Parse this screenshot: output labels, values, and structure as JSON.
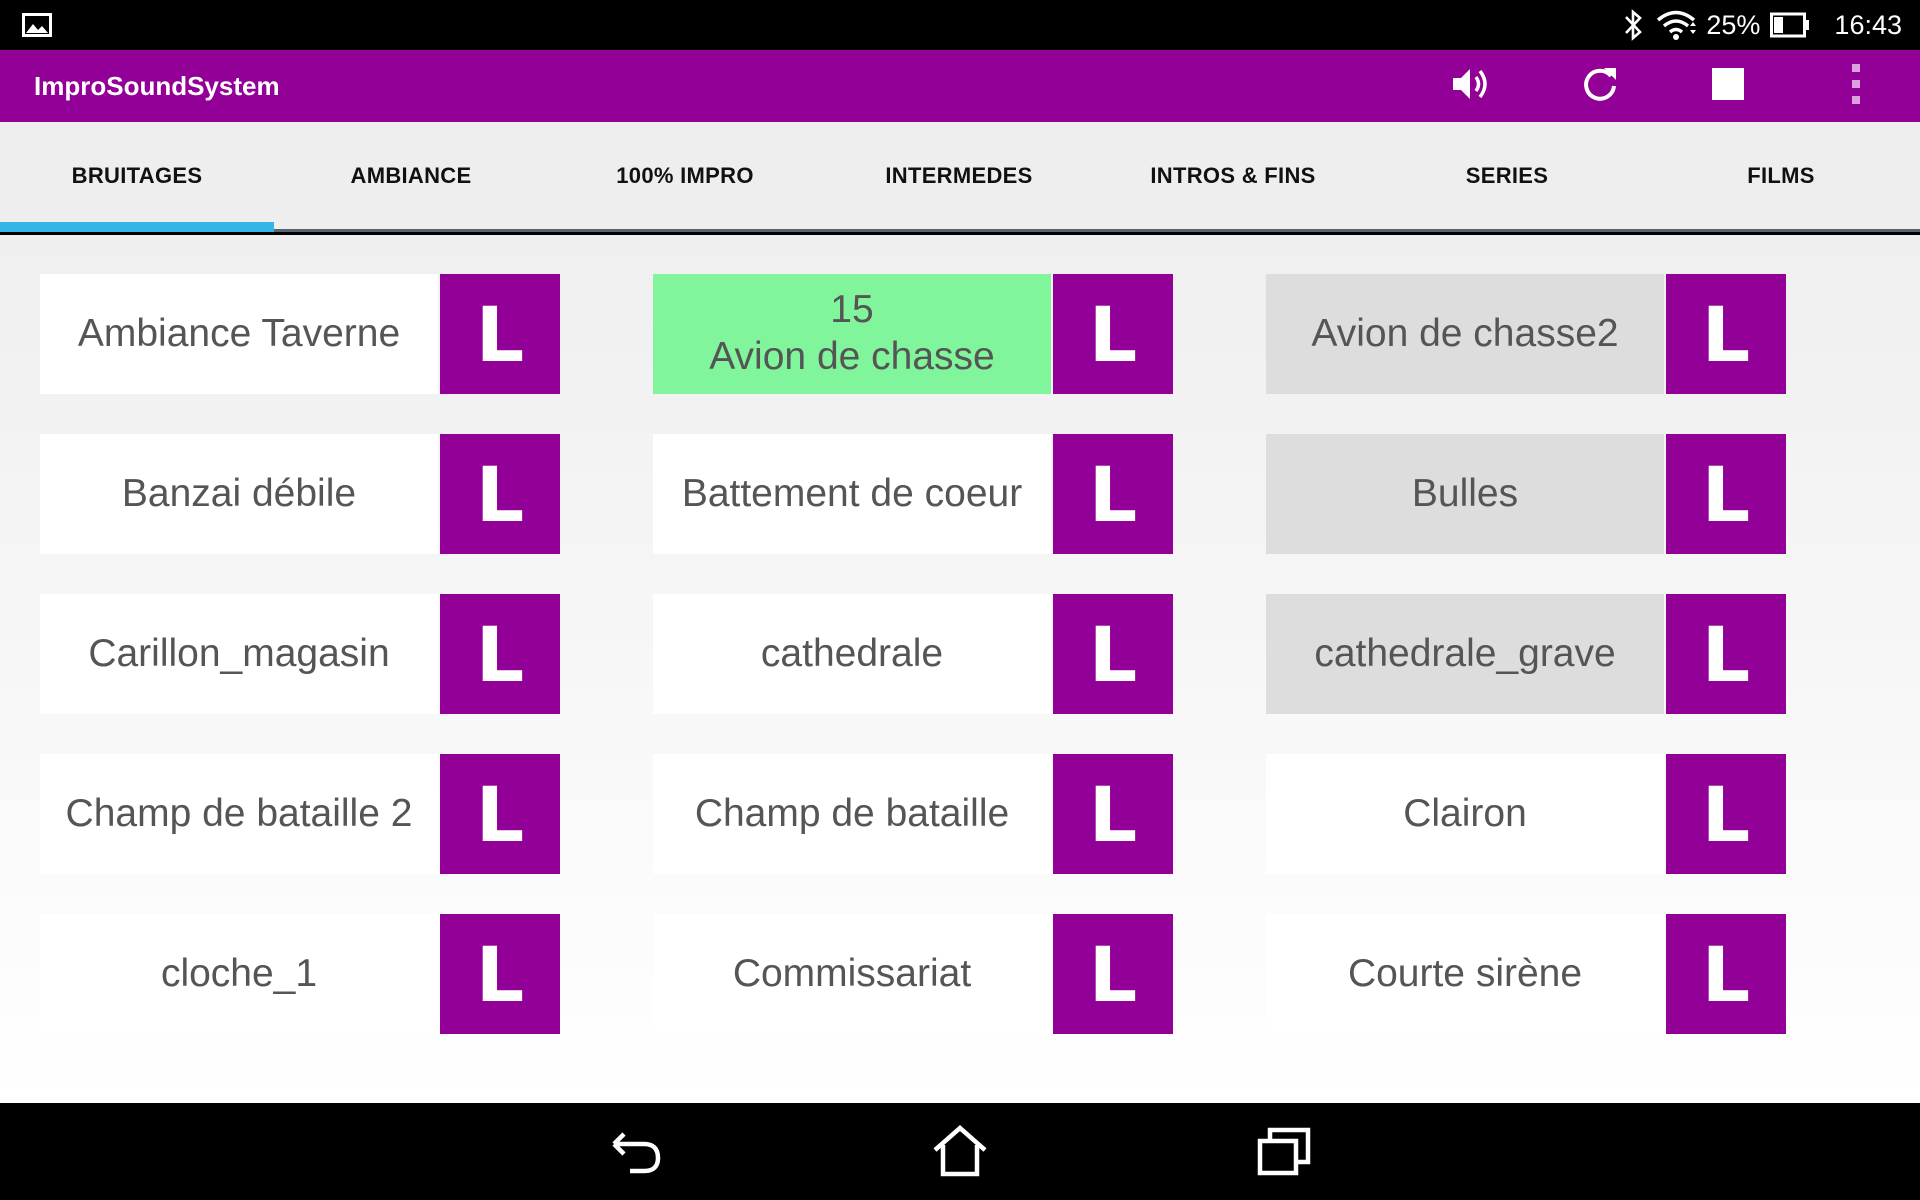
{
  "status_bar": {
    "battery_percent": "25%",
    "time": "16:43",
    "icons": [
      "image-notification-icon",
      "bluetooth-icon",
      "wifi-icon",
      "battery-icon"
    ]
  },
  "app_bar": {
    "title": "ImproSoundSystem",
    "actions": [
      "volume-icon",
      "refresh-icon",
      "stop-icon",
      "overflow-menu-icon"
    ]
  },
  "tabs": [
    {
      "label": "BRUITAGES",
      "selected": true
    },
    {
      "label": "AMBIANCE",
      "selected": false
    },
    {
      "label": "100% IMPRO",
      "selected": false
    },
    {
      "label": "INTERMEDES",
      "selected": false
    },
    {
      "label": "INTROS & FINS",
      "selected": false
    },
    {
      "label": "SERIES",
      "selected": false
    },
    {
      "label": "FILMS",
      "selected": false
    }
  ],
  "sounds": {
    "loop_label": "L",
    "rows": [
      [
        {
          "counter": "",
          "name": "Ambiance Taverne",
          "state": "normal"
        },
        {
          "counter": "15",
          "name": "Avion de chasse",
          "state": "playing"
        },
        {
          "counter": "",
          "name": "Avion de chasse2",
          "state": "disabled"
        }
      ],
      [
        {
          "counter": "",
          "name": "Banzai débile",
          "state": "normal"
        },
        {
          "counter": "",
          "name": "Battement de coeur",
          "state": "normal"
        },
        {
          "counter": "",
          "name": "Bulles",
          "state": "disabled"
        }
      ],
      [
        {
          "counter": "",
          "name": "Carillon_magasin",
          "state": "normal"
        },
        {
          "counter": "",
          "name": "cathedrale",
          "state": "normal"
        },
        {
          "counter": "",
          "name": "cathedrale_grave",
          "state": "disabled"
        }
      ],
      [
        {
          "counter": "",
          "name": "Champ de bataille 2",
          "state": "normal"
        },
        {
          "counter": "",
          "name": "Champ de bataille",
          "state": "normal"
        },
        {
          "counter": "",
          "name": "Clairon",
          "state": "normal"
        }
      ],
      [
        {
          "counter": "",
          "name": "cloche_1",
          "state": "normal"
        },
        {
          "counter": "",
          "name": "Commissariat",
          "state": "normal"
        },
        {
          "counter": "",
          "name": "Courte sirène",
          "state": "normal"
        }
      ]
    ]
  },
  "colors": {
    "primary": "#930097",
    "tab_indicator": "#33b5e5",
    "playing": "#80f59b",
    "disabled": "#dddddd"
  },
  "nav_bar": [
    "back-icon",
    "home-icon",
    "recent-apps-icon"
  ]
}
